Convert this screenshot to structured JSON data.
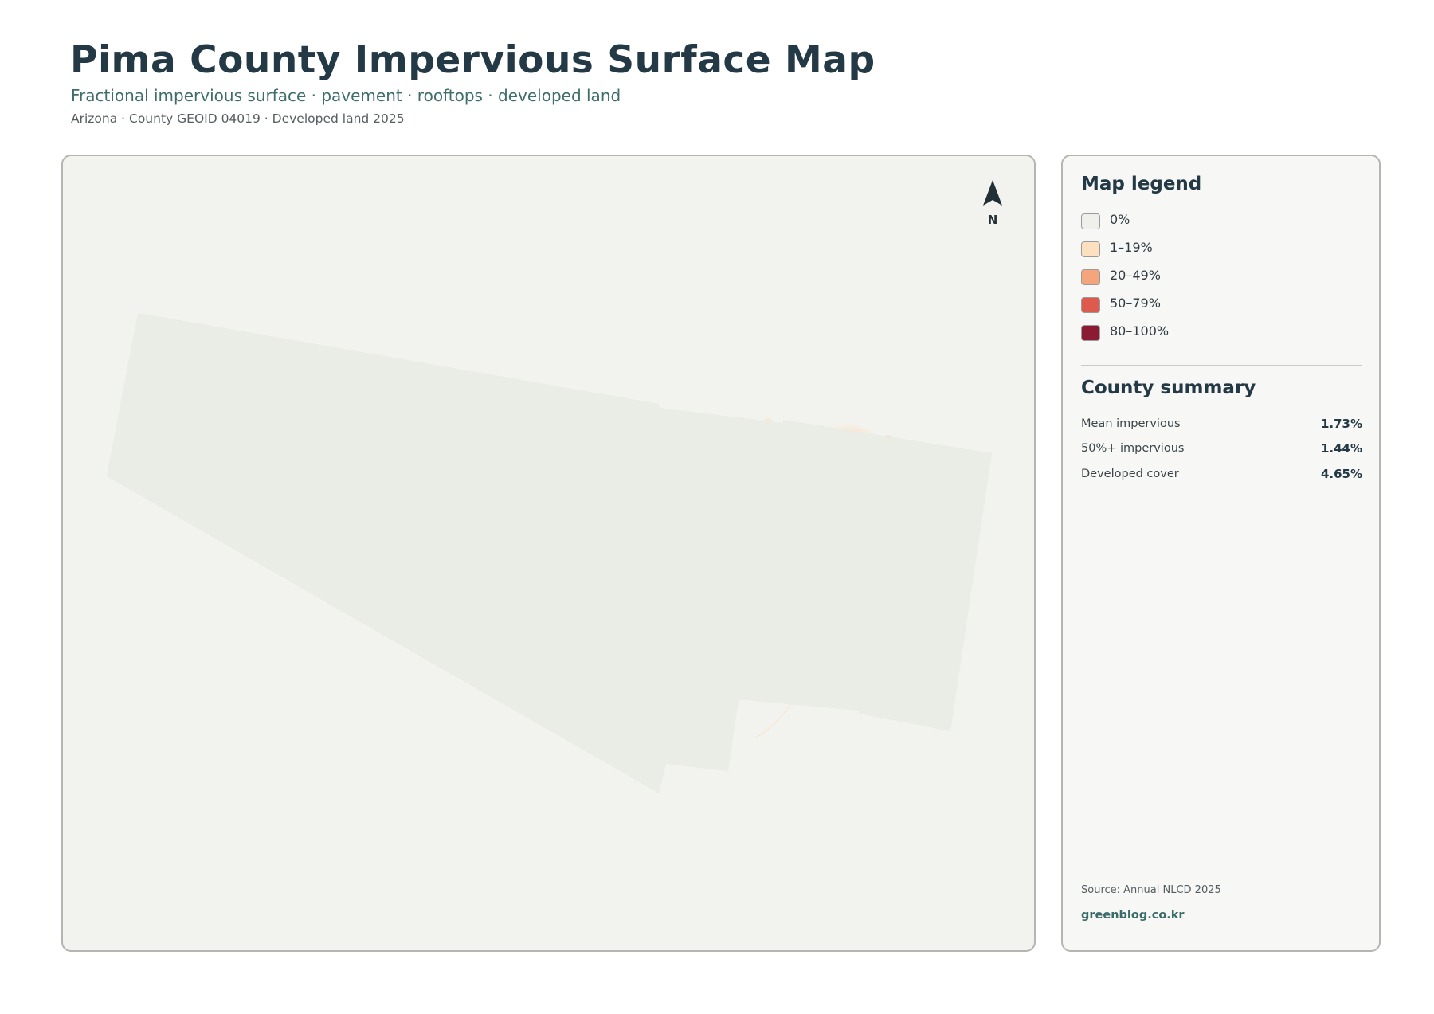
{
  "header": {
    "title": "Pima County Impervious Surface Map",
    "subtitle": "Fractional impervious surface · pavement · rooftops · developed land",
    "meta": "Arizona · County GEOID 04019 · Developed land 2025"
  },
  "map": {
    "north_label": "N",
    "fill_color": "#eaece6",
    "outline_color": "#203036",
    "icons": [
      "north-arrow-icon"
    ]
  },
  "legend": {
    "title": "Map legend",
    "items": [
      {
        "label": "0%",
        "color": "#efefeb"
      },
      {
        "label": "1–19%",
        "color": "#fde0bf"
      },
      {
        "label": "20–49%",
        "color": "#f4a57c"
      },
      {
        "label": "50–79%",
        "color": "#de5a4c"
      },
      {
        "label": "80–100%",
        "color": "#8b1a33"
      }
    ]
  },
  "summary": {
    "title": "County summary",
    "rows": [
      {
        "label": "Mean impervious",
        "value": "1.73%"
      },
      {
        "label": "50%+ impervious",
        "value": "1.44%"
      },
      {
        "label": "Developed cover",
        "value": "4.65%"
      }
    ]
  },
  "footer": {
    "source": "Source: Annual NLCD 2025",
    "credit": "greenblog.co.kr"
  }
}
